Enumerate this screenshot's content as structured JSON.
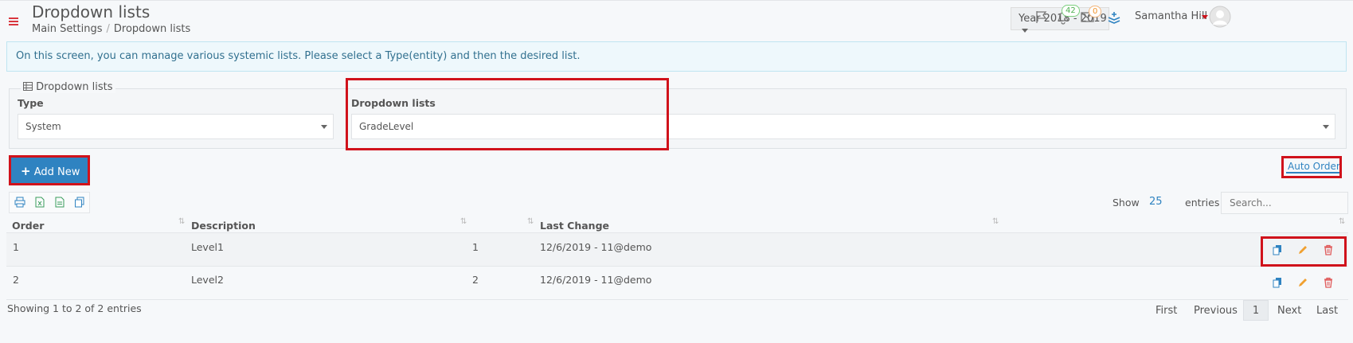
{
  "header": {
    "title": "Dropdown lists",
    "breadcrumb": [
      "Main Settings",
      "Dropdown lists"
    ],
    "year_select": "Year 2018 - 2019",
    "notif_count": "42",
    "mail_count": "0",
    "user_name": "Samantha Hill"
  },
  "info_text": "On this screen, you can manage various systemic lists. Please select a Type(entity) and then the desired list.",
  "filter": {
    "legend": "Dropdown lists",
    "type_label": "Type",
    "type_value": "System",
    "list_label": "Dropdown lists",
    "list_value": "GradeLevel"
  },
  "toolbar": {
    "add_label": "Add New",
    "auto_order_label": "Auto Order",
    "show_label": "Show",
    "show_value": "25",
    "entries_label": "entries",
    "search_placeholder": "Search..."
  },
  "table": {
    "headers": [
      "Order",
      "Description",
      "",
      "Last Change"
    ],
    "rows": [
      {
        "order": "1",
        "description": "Level1",
        "value": "1",
        "last_change": "12/6/2019 - 11@demo"
      },
      {
        "order": "2",
        "description": "Level2",
        "value": "2",
        "last_change": "12/6/2019 - 11@demo"
      }
    ]
  },
  "footer": {
    "showing": "Showing 1 to 2 of 2 entries",
    "first": "First",
    "previous": "Previous",
    "page": "1",
    "next": "Next",
    "last": "Last"
  },
  "colors": {
    "accent": "#2f83c1",
    "highlight": "#d0121b",
    "edit": "#f0a030",
    "delete": "#e05a5a"
  }
}
